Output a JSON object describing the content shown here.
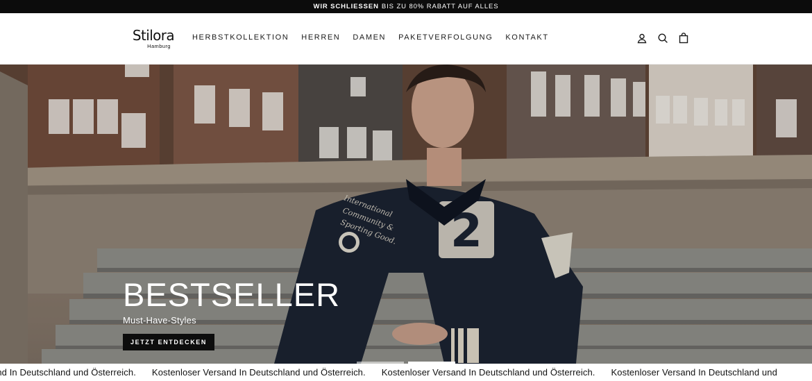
{
  "announcement": {
    "strong": "WIR SCHLIESSEN",
    "rest": "BIS ZU 80% RABATT AUF ALLES"
  },
  "header": {
    "logo_main": "Stilora",
    "logo_sub": "Hamburg",
    "nav": [
      {
        "label": "HERBSTKOLLEKTION"
      },
      {
        "label": "HERREN"
      },
      {
        "label": "DAMEN"
      },
      {
        "label": "PAKETVERFOLGUNG"
      },
      {
        "label": "KONTAKT"
      }
    ],
    "icons": [
      "account-icon",
      "search-icon",
      "cart-icon"
    ]
  },
  "hero": {
    "title": "BESTSELLER",
    "subtitle": "Must-Have-Styles",
    "cta": "JETZT ENTDECKEN",
    "slides_total": 2,
    "active_slide": 2
  },
  "marquee": {
    "items": [
      "and In Deutschland und Österreich.",
      "Kostenloser Versand In Deutschland und Österreich.",
      "Kostenloser Versand In Deutschland und Österreich.",
      "Kostenloser Versand In Deutschland und"
    ]
  }
}
